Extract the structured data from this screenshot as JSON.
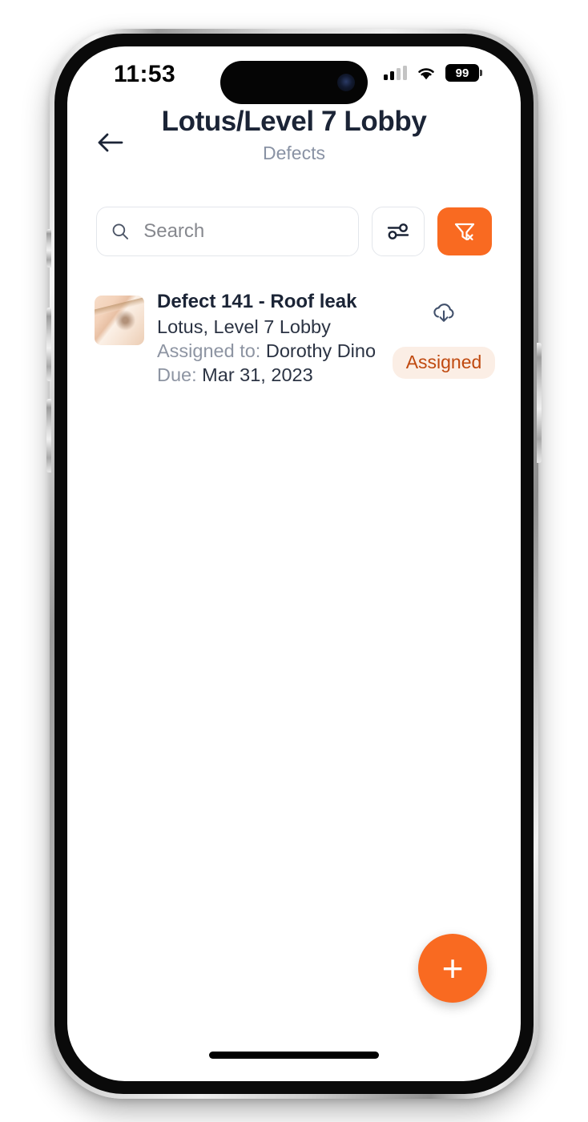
{
  "status_bar": {
    "time": "11:53",
    "battery_level": "99",
    "signal_icon": "cellular-signal-icon",
    "wifi_icon": "wifi-icon",
    "battery_icon": "battery-icon"
  },
  "header": {
    "back_icon": "back-arrow-icon",
    "title": "Lotus/Level 7 Lobby",
    "subtitle": "Defects"
  },
  "search": {
    "placeholder": "Search",
    "value": "",
    "search_icon": "search-icon",
    "sliders_icon": "sliders-icon",
    "clear_filter_icon": "filter-remove-icon",
    "clear_filter_color": "#f96a21"
  },
  "defects": [
    {
      "title": "Defect 141 - Roof leak",
      "location": "Lotus, Level 7 Lobby",
      "assigned_label": "Assigned to:",
      "assigned_value": "Dorothy Dino",
      "due_label": "Due:",
      "due_value": "Mar 31, 2023",
      "download_icon": "cloud-download-icon",
      "status": "Assigned",
      "status_text_color": "#c0490f",
      "status_bg_color": "#fbeee5",
      "thumbnail_alt": "defect-photo-thumbnail"
    }
  ],
  "fab": {
    "label": "+",
    "icon": "plus-icon",
    "color": "#f96a21"
  },
  "colors": {
    "accent": "#f96a21",
    "title": "#1b2436",
    "muted": "#8992a4"
  }
}
